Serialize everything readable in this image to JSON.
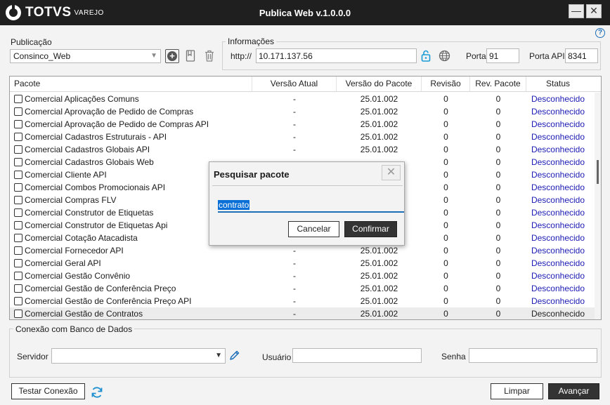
{
  "window": {
    "brand": "TOTVS",
    "brand_sub": "VAREJO",
    "title": "Publica Web v.1.0.0.0",
    "minimize_label": "—",
    "close_label": "✕"
  },
  "help_label": "?",
  "publicacao": {
    "label": "Publicação",
    "selected": "Consinco_Web"
  },
  "informacoes": {
    "label": "Informações",
    "protocol": "http://",
    "host": "10.171.137.56",
    "porta_label": "Porta",
    "porta": "91",
    "porta_api_label": "Porta API",
    "porta_api": "8341"
  },
  "table": {
    "columns": [
      "Pacote",
      "Versão Atual",
      "Versão do Pacote",
      "Revisão",
      "Rev. Pacote",
      "Status"
    ],
    "rows": [
      {
        "pacote": "Comercial Aplicações Comuns",
        "atual": "-",
        "versao": "25.01.002",
        "revisao": "0",
        "rev_pacote": "0",
        "status": "Desconhecido"
      },
      {
        "pacote": "Comercial Aprovação de Pedido de Compras",
        "atual": "-",
        "versao": "25.01.002",
        "revisao": "0",
        "rev_pacote": "0",
        "status": "Desconhecido"
      },
      {
        "pacote": "Comercial Aprovação de Pedido de Compras API",
        "atual": "-",
        "versao": "25.01.002",
        "revisao": "0",
        "rev_pacote": "0",
        "status": "Desconhecido"
      },
      {
        "pacote": "Comercial Cadastros Estruturais - API",
        "atual": "-",
        "versao": "25.01.002",
        "revisao": "0",
        "rev_pacote": "0",
        "status": "Desconhecido"
      },
      {
        "pacote": "Comercial Cadastros Globais API",
        "atual": "-",
        "versao": "25.01.002",
        "revisao": "0",
        "rev_pacote": "0",
        "status": "Desconhecido"
      },
      {
        "pacote": "Comercial Cadastros Globais Web",
        "atual": "",
        "versao": "",
        "revisao": "0",
        "rev_pacote": "0",
        "status": "Desconhecido"
      },
      {
        "pacote": "Comercial Cliente API",
        "atual": "",
        "versao": "",
        "revisao": "0",
        "rev_pacote": "0",
        "status": "Desconhecido"
      },
      {
        "pacote": "Comercial Combos Promocionais API",
        "atual": "",
        "versao": "",
        "revisao": "0",
        "rev_pacote": "0",
        "status": "Desconhecido"
      },
      {
        "pacote": "Comercial Compras FLV",
        "atual": "",
        "versao": "",
        "revisao": "0",
        "rev_pacote": "0",
        "status": "Desconhecido"
      },
      {
        "pacote": "Comercial Construtor de Etiquetas",
        "atual": "",
        "versao": "",
        "revisao": "0",
        "rev_pacote": "0",
        "status": "Desconhecido"
      },
      {
        "pacote": "Comercial Construtor de Etiquetas Api",
        "atual": "",
        "versao": "",
        "revisao": "0",
        "rev_pacote": "0",
        "status": "Desconhecido"
      },
      {
        "pacote": "Comercial Cotação Atacadista",
        "atual": "",
        "versao": "",
        "revisao": "0",
        "rev_pacote": "0",
        "status": "Desconhecido"
      },
      {
        "pacote": "Comercial Fornecedor API",
        "atual": "-",
        "versao": "25.01.002",
        "revisao": "0",
        "rev_pacote": "0",
        "status": "Desconhecido"
      },
      {
        "pacote": "Comercial Geral API",
        "atual": "-",
        "versao": "25.01.002",
        "revisao": "0",
        "rev_pacote": "0",
        "status": "Desconhecido"
      },
      {
        "pacote": "Comercial Gestão Convênio",
        "atual": "-",
        "versao": "25.01.002",
        "revisao": "0",
        "rev_pacote": "0",
        "status": "Desconhecido"
      },
      {
        "pacote": "Comercial Gestão de Conferência Preço",
        "atual": "-",
        "versao": "25.01.002",
        "revisao": "0",
        "rev_pacote": "0",
        "status": "Desconhecido"
      },
      {
        "pacote": "Comercial Gestão de Conferência Preço API",
        "atual": "-",
        "versao": "25.01.002",
        "revisao": "0",
        "rev_pacote": "0",
        "status": "Desconhecido"
      },
      {
        "pacote": "Comercial Gestão de Contratos",
        "atual": "-",
        "versao": "25.01.002",
        "revisao": "0",
        "rev_pacote": "0",
        "status": "Desconhecido",
        "selected": true
      }
    ]
  },
  "dialog": {
    "title": "Pesquisar pacote",
    "close_label": "✕",
    "search_value": "contrato",
    "cancel_label": "Cancelar",
    "confirm_label": "Confirmar"
  },
  "conexao": {
    "label": "Conexão com Banco de Dados",
    "servidor_label": "Servidor",
    "servidor_value": "",
    "usuario_label": "Usuário",
    "usuario_value": "",
    "senha_label": "Senha",
    "senha_value": ""
  },
  "footer": {
    "testar_label": "Testar Conexão",
    "limpar_label": "Limpar",
    "avancar_label": "Avançar"
  },
  "colors": {
    "accent": "#1d6fb8",
    "status_link": "#1b1bb5",
    "titlebar": "#1f1f1f",
    "lock": "#1a9bd7"
  },
  "icons": [
    "totvs-logo-icon",
    "help-icon",
    "add-icon",
    "bookmark-icon",
    "trash-icon",
    "lock-icon",
    "globe-icon",
    "pencil-icon",
    "refresh-icon",
    "chevron-down-icon",
    "close-icon"
  ]
}
